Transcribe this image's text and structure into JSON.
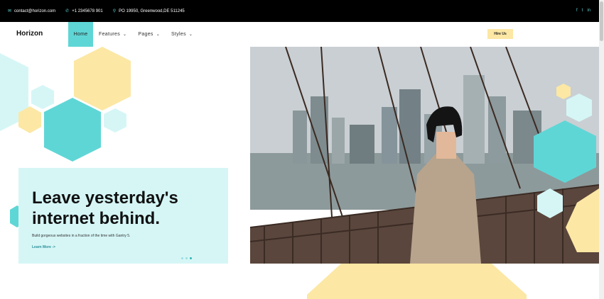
{
  "topbar": {
    "email": "contact@horizon.com",
    "phone": "+1 2345678 901",
    "address": "PO 19950, Greenwood,DE 511245",
    "icons": {
      "email": "envelope-icon",
      "phone": "phone-icon",
      "address": "map-pin-icon"
    },
    "socials": [
      {
        "icon": "facebook-icon",
        "glyph": "f"
      },
      {
        "icon": "twitter-icon",
        "glyph": "t"
      },
      {
        "icon": "linkedin-icon",
        "glyph": "in"
      }
    ]
  },
  "nav": {
    "logo": "Horizon",
    "items": [
      {
        "label": "Home",
        "active": true
      },
      {
        "label": "Features",
        "dropdown": true
      },
      {
        "label": "Pages",
        "dropdown": true
      },
      {
        "label": "Styles",
        "dropdown": true
      }
    ],
    "cta": "Hire Us"
  },
  "hero": {
    "headline_line1": "Leave yesterday's",
    "headline_line2": "internet behind.",
    "subtext": "Build gorgeous websites in a fraction of the time with Gantry 5.",
    "link": "Learn More ->",
    "slides": 3,
    "active_slide": 3
  },
  "colors": {
    "accent_teal": "#5fd6d6",
    "light_teal": "#d6f6f6",
    "accent_yellow": "#fce7a4",
    "topbar_bg": "#000000"
  }
}
